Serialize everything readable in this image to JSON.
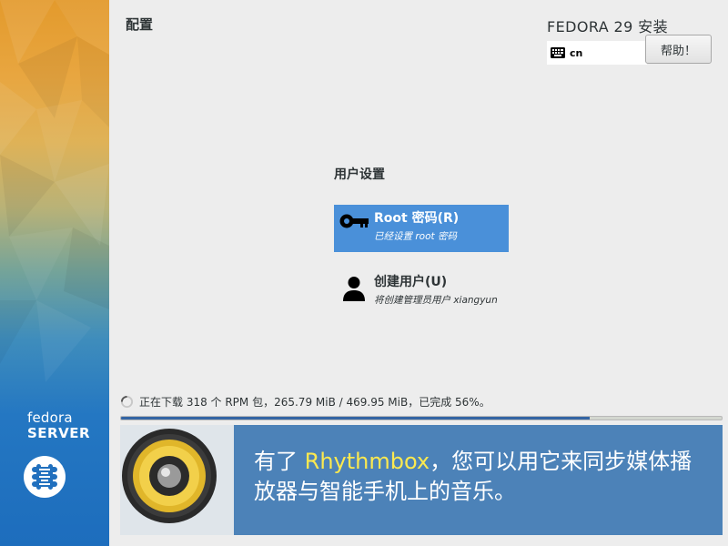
{
  "sidebar": {
    "brand_name": "fedora",
    "product_name": "SERVER"
  },
  "header": {
    "page_title": "配置",
    "product_title": "FEDORA 29 安装",
    "keyboard_layout": "cn",
    "help_button_label": "帮助！"
  },
  "user_settings": {
    "title": "用户设置",
    "spokes": [
      {
        "title": "Root 密码(R)",
        "status": "已经设置 root 密码",
        "icon": "key-icon",
        "selected": true
      },
      {
        "title": "创建用户(U)",
        "status": "将创建管理员用户 xiangyun",
        "icon": "user-icon",
        "selected": false
      }
    ]
  },
  "progress": {
    "status_text": "正在下载 318 个 RPM 包，265.79 MiB / 469.95 MiB，已完成 56%。",
    "fraction": 0.78
  },
  "banner": {
    "text_before": "有了 ",
    "highlight": "Rhythmbox",
    "text_after": "，您可以用它来同步媒体播放器与智能手机上的音乐。"
  },
  "colors": {
    "selected_spoke": "#4a90d9",
    "progress_fill": "#3465a4",
    "banner_bg": "#4c82b8",
    "highlight": "#fce94f"
  }
}
